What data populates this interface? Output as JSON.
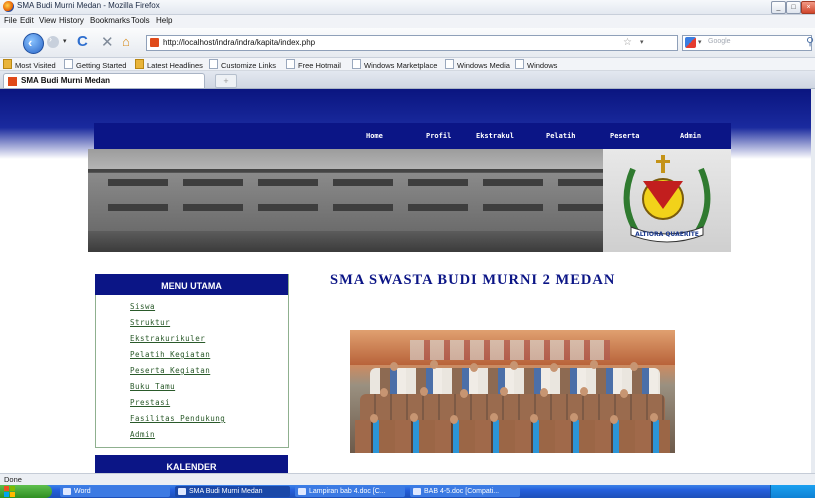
{
  "window": {
    "title": "SMA Budi Murni Medan - Mozilla Firefox",
    "controls": [
      "_",
      "□",
      "×"
    ]
  },
  "menubar": [
    "File",
    "Edit",
    "View",
    "History",
    "Bookmarks",
    "Tools",
    "Help"
  ],
  "navigation": {
    "url": "http://localhost/indra/indra/kapita/index.php",
    "search_placeholder": "Google"
  },
  "bookmarks": [
    {
      "label": "Most Visited",
      "icon": "folder-icon"
    },
    {
      "label": "Getting Started",
      "icon": "page-icon"
    },
    {
      "label": "Latest Headlines",
      "icon": "folder-icon"
    },
    {
      "label": "Customize Links",
      "icon": "page-icon"
    },
    {
      "label": "Free Hotmail",
      "icon": "page-icon"
    },
    {
      "label": "Windows Marketplace",
      "icon": "page-icon"
    },
    {
      "label": "Windows Media",
      "icon": "page-icon"
    },
    {
      "label": "Windows",
      "icon": "page-icon"
    }
  ],
  "tab": {
    "title": "SMA Budi Murni Medan",
    "new_tab": "+"
  },
  "site": {
    "nav": [
      "Home",
      "Profil",
      "Ekstrakul",
      "Pelatih",
      "Peserta",
      "Admin"
    ],
    "crest_motto": "ALTIORA QUAERITE",
    "title": "SMA SWASTA BUDI MURNI 2 MEDAN",
    "menu_heading": "MENU UTAMA",
    "menu_items": [
      "Siswa",
      "Struktur",
      "Ekstrakurikuler",
      "Pelatih Kegiatan",
      "Peserta Kegiatan",
      "Buku Tamu",
      "Prestasi",
      "Fasilitas Pendukung",
      "Admin"
    ],
    "calendar_heading": "KALENDER"
  },
  "status": "Done",
  "taskbar": {
    "start": "",
    "items": [
      "Word",
      "SMA Budi Murni Medan",
      "Lampiran bab 4.doc [C...",
      "BAB 4-5.doc [Compati..."
    ]
  }
}
